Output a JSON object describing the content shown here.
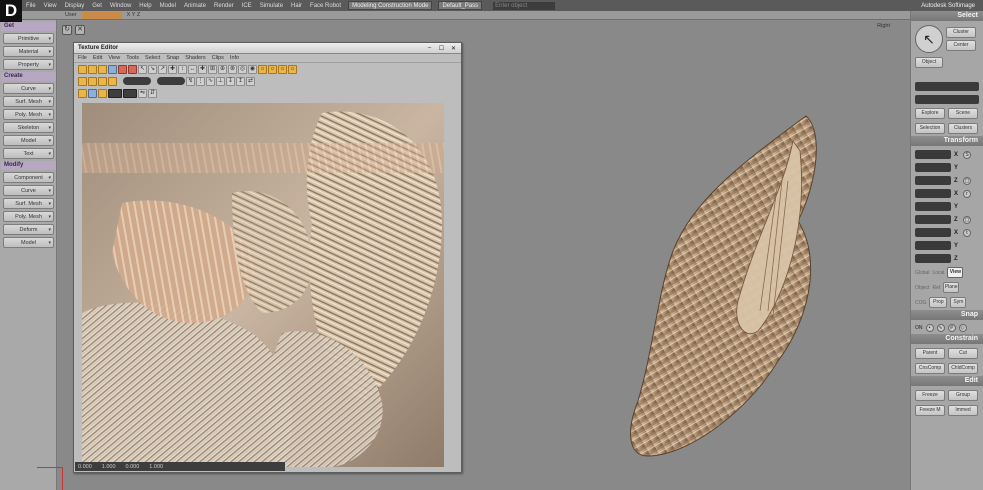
{
  "figure_label": "D",
  "menubar": {
    "items": [
      "",
      "File",
      "View",
      "Display",
      "Get",
      "Window",
      "Help",
      "Model",
      "Animate",
      "Render",
      "ICE",
      "Simulate",
      "Hair",
      "Face Robot"
    ],
    "layout_dropdown": "Modeling Construction Mode",
    "selection_dropdown": "Default_Pass",
    "search_placeholder": "Enter object",
    "brand": "Autodesk Softimage"
  },
  "viewbar": {
    "camera": "User",
    "axes": "X Y Z",
    "view_label": "Right"
  },
  "left_panel": {
    "get_header": "Get",
    "get_items": [
      "Primitive",
      "Material",
      "Property"
    ],
    "create_header": "Create",
    "create_items": [
      "Curve",
      "Surf. Mesh",
      "Poly. Mesh",
      "Skeleton",
      "Model",
      "Text"
    ],
    "modify_header": "Modify",
    "modify_items": [
      "Component",
      "Curve",
      "Surf. Mesh",
      "Poly. Mesh",
      "Deform",
      "Model"
    ]
  },
  "texture_editor": {
    "title": "Texture Editor",
    "menu": [
      "File",
      "Edit",
      "View",
      "Tools",
      "Select",
      "Snap",
      "Shaders",
      "Clips",
      "Info"
    ],
    "status_values": [
      "0.000",
      "1.000",
      "0.000",
      "1.000"
    ]
  },
  "right_panel": {
    "select_header": "Select",
    "cluster_label": "Cluster",
    "center_label": "Center",
    "object_label": "Object",
    "explore_label": "Explore",
    "scene_label": "Scene",
    "selection_label": "Selection",
    "clusters_label": "Clusters",
    "transform_header": "Transform",
    "axis_x": "X",
    "axis_y": "Y",
    "axis_z": "Z",
    "global_label": "Global",
    "local_label": "Local",
    "view_label": "View",
    "object2_label": "Object",
    "ref_label": "Ref",
    "plane_label": "Plane",
    "cog_label": "COG",
    "prop_label": "Prop",
    "sym_label": "Sym",
    "snap_header": "Snap",
    "snap_on": "ON",
    "constrain_header": "Constrain",
    "parent_label": "Parent",
    "cut_label": "Cut",
    "cnscomp_label": "CnsComp",
    "chldcomp_label": "ChldComp",
    "edit_header": "Edit",
    "freeze_label": "Freeze",
    "group_label": "Group",
    "freezem_label": "Freeze M",
    "immed_label": "Immed"
  },
  "colors": {
    "app_bg": "#898989",
    "panel_bg": "#a6a6a6",
    "header_purple": "#b7a7c2",
    "shell_cream": "#d7c2a3",
    "shell_brown": "#7d5a3e"
  }
}
